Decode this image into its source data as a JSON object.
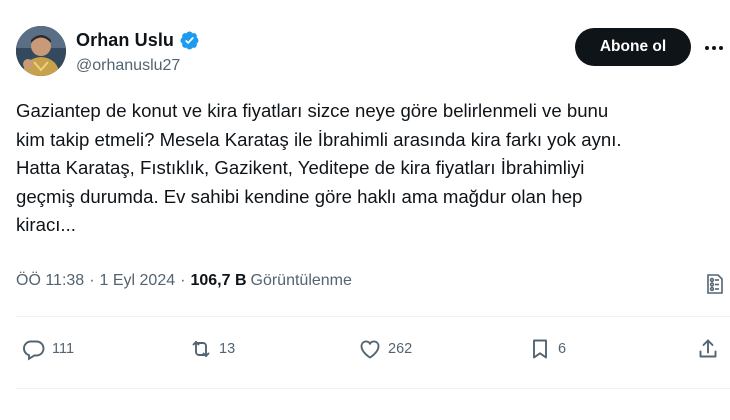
{
  "author": {
    "display_name": "Orhan Uslu",
    "handle": "@orhanuslu27",
    "verified_icon": "verified-badge-icon"
  },
  "header": {
    "follow_label": "Abone ol",
    "more_icon": "more-icon"
  },
  "tweet": {
    "lines": [
      "Gaziantep de konut ve kira fiyatları sizce neye göre belirlenmeli ve bunu",
      "kim takip etmeli? Mesela Karataş ile İbrahimli arasında kira farkı yok aynı.",
      "Hatta Karataş, Fıstıklık, Gazikent, Yeditepe de kira fiyatları İbrahimliyi",
      "geçmiş durumda. Ev sahibi kendine göre haklı ama mağdur olan hep",
      "kiracı..."
    ]
  },
  "meta": {
    "time": "ÖÖ 11:38",
    "separator": "·",
    "date": "1 Eyl 2024",
    "views_count": "106,7 B",
    "views_label": "Görüntülenme"
  },
  "actions": {
    "replies": "111",
    "reposts": "13",
    "likes": "262",
    "bookmarks": "6"
  },
  "colors": {
    "text_primary": "#0f1419",
    "text_secondary": "#536471",
    "verified_blue": "#1d9bf0",
    "divider": "#eff3f4"
  }
}
